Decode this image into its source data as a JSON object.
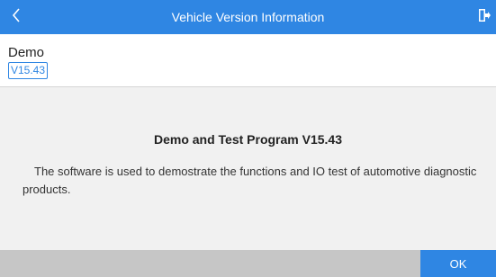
{
  "header": {
    "title": "Vehicle Version Information",
    "back_icon": "chevron-left-icon",
    "exit_icon": "exit-icon",
    "color": "#2f86e3"
  },
  "vehicle": {
    "name": "Demo",
    "version": "V15.43"
  },
  "program": {
    "title": "Demo and Test Program V15.43",
    "description": "The software is used to demostrate the functions and IO test of automotive diagnostic products."
  },
  "footer": {
    "ok_label": "OK"
  }
}
